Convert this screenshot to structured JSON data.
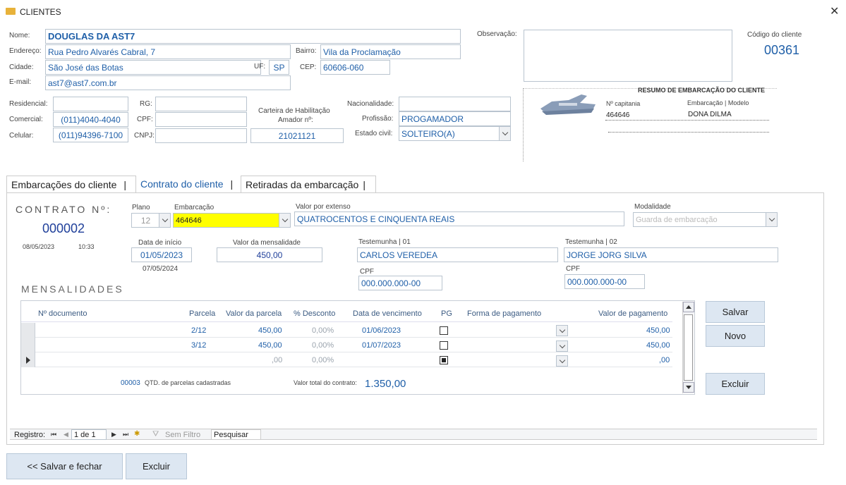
{
  "window": {
    "title": "CLIENTES"
  },
  "client": {
    "nome_label": "Nome:",
    "nome": "DOUGLAS DA AST7",
    "endereco_label": "Endereço:",
    "endereco": "Rua Pedro Alvarés Cabral, 7",
    "bairro_label": "Bairro:",
    "bairro": "Vila da Proclamação",
    "cidade_label": "Cidade:",
    "cidade": "São José das Botas",
    "uf_label": "UF:",
    "uf": "SP",
    "cep_label": "CEP:",
    "cep": "60606-060",
    "email_label": "E-mail:",
    "email": "ast7@ast7.com.br",
    "observacao_label": "Observação:",
    "observacao": "",
    "codigo_label": "Código do cliente",
    "codigo": "00361",
    "residencial_label": "Residencial:",
    "residencial": "",
    "comercial_label": "Comercial:",
    "comercial": "(011)4040-4040",
    "celular_label": "Celular:",
    "celular": "(011)94396-7100",
    "rg_label": "RG:",
    "rg": "",
    "cpf_label": "CPF:",
    "cpf": "",
    "cnpj_label": "CNPJ:",
    "cnpj": "",
    "carteira_label1": "Carteira de Habilitação",
    "carteira_label2": "Amador nº:",
    "carteira": "21021121",
    "nacionalidade_label": "Nacionalidade:",
    "nacionalidade": "",
    "profissao_label": "Profissão:",
    "profissao": "PROGAMADOR",
    "estado_civil_label": "Estado civil:",
    "estado_civil": "SOLTEIRO(A)"
  },
  "resumo": {
    "title": "RESUMO DE EMBARCAÇÃO DO CLIENTE",
    "capitania_label": "Nº capitania",
    "capitania": "464646",
    "modelo_label": "Embarcação | Modelo",
    "modelo": "DONA DILMA",
    "icon": "jetski-icon"
  },
  "tabs": [
    {
      "label": "Embarcações do cliente"
    },
    {
      "label": "Contrato do cliente"
    },
    {
      "label": "Retiradas da embarcação"
    }
  ],
  "contrato": {
    "title": "CONTRATO Nº:",
    "numero": "000002",
    "data": "08/05/2023",
    "hora": "10:33",
    "plano_label": "Plano",
    "plano": "12",
    "embarcacao_label": "Embarcação",
    "embarcacao": "464646",
    "extenso_label": "Valor por extenso",
    "extenso": "QUATROCENTOS E CINQUENTA REAIS",
    "modalidade_label": "Modalidade",
    "modalidade_placeholder": "Guarda de embarcação",
    "inicio_label": "Data de início",
    "inicio": "01/05/2023",
    "fim": "07/05/2024",
    "mensalidade_label": "Valor da mensalidade",
    "mensalidade": "450,00",
    "test1_label": "Testemunha | 01",
    "test1": "CARLOS VEREDEA",
    "test1_cpf_label": "CPF",
    "test1_cpf": "000.000.000-00",
    "test2_label": "Testemunha | 02",
    "test2": "JORGE JORG SILVA",
    "test2_cpf_label": "CPF",
    "test2_cpf": "000.000.000-00"
  },
  "mensalidades": {
    "title": "MENSALIDADES",
    "headers": [
      "Nº documento",
      "Parcela",
      "Valor da parcela",
      "% Desconto",
      "Data de vencimento",
      "PG",
      "Forma de pagamento",
      "Valor de pagamento"
    ],
    "rows": [
      {
        "doc": "",
        "parcela": "2/12",
        "valor": "450,00",
        "desconto": "0,00%",
        "vencimento": "01/06/2023",
        "pg": false,
        "forma": "",
        "pagamento": "450,00"
      },
      {
        "doc": "",
        "parcela": "3/12",
        "valor": "450,00",
        "desconto": "0,00%",
        "vencimento": "01/07/2023",
        "pg": false,
        "forma": "",
        "pagamento": "450,00"
      },
      {
        "doc": "",
        "parcela": "",
        "valor": ",00",
        "desconto": "0,00%",
        "vencimento": "",
        "pg": true,
        "forma": "",
        "pagamento": ",00"
      }
    ],
    "qtd": "00003",
    "qtd_label": "QTD. de parcelas cadastradas",
    "total_label": "Valor total do contrato:",
    "total": "1.350,00"
  },
  "buttons": {
    "salvar": "Salvar",
    "novo": "Novo",
    "excluir": "Excluir",
    "salvar_fechar": "<< Salvar e fechar",
    "excluir_bottom": "Excluir"
  },
  "nav": {
    "registro_label": "Registro:",
    "record": "1 de 1",
    "sem_filtro": "Sem Filtro",
    "pesquisar": "Pesquisar"
  },
  "colors": {
    "accent": "#1f5fa8",
    "highlight": "#ffff00",
    "button": "#dde7f2"
  }
}
